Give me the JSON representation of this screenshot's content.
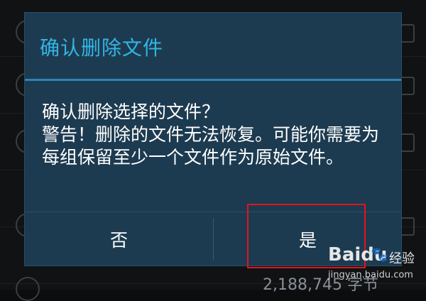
{
  "dialog": {
    "title": "确认删除文件",
    "message_line1": "确认删除选择的文件？",
    "message_line2": "警告！删除的文件无法恢复。可能你需要为每组保留至少一个文件作为原始文件。",
    "button_no": "否",
    "button_yes": "是"
  },
  "background": {
    "file_size": "2,188,745 字节"
  },
  "watermark": {
    "logo": "Baidu",
    "brand": "经验",
    "url": "jingyan.baidu.com"
  },
  "colors": {
    "dialog_bg": "#1d3b50",
    "title": "#33b5e5",
    "divider": "#2a86b3",
    "highlight": "#e0141e"
  }
}
